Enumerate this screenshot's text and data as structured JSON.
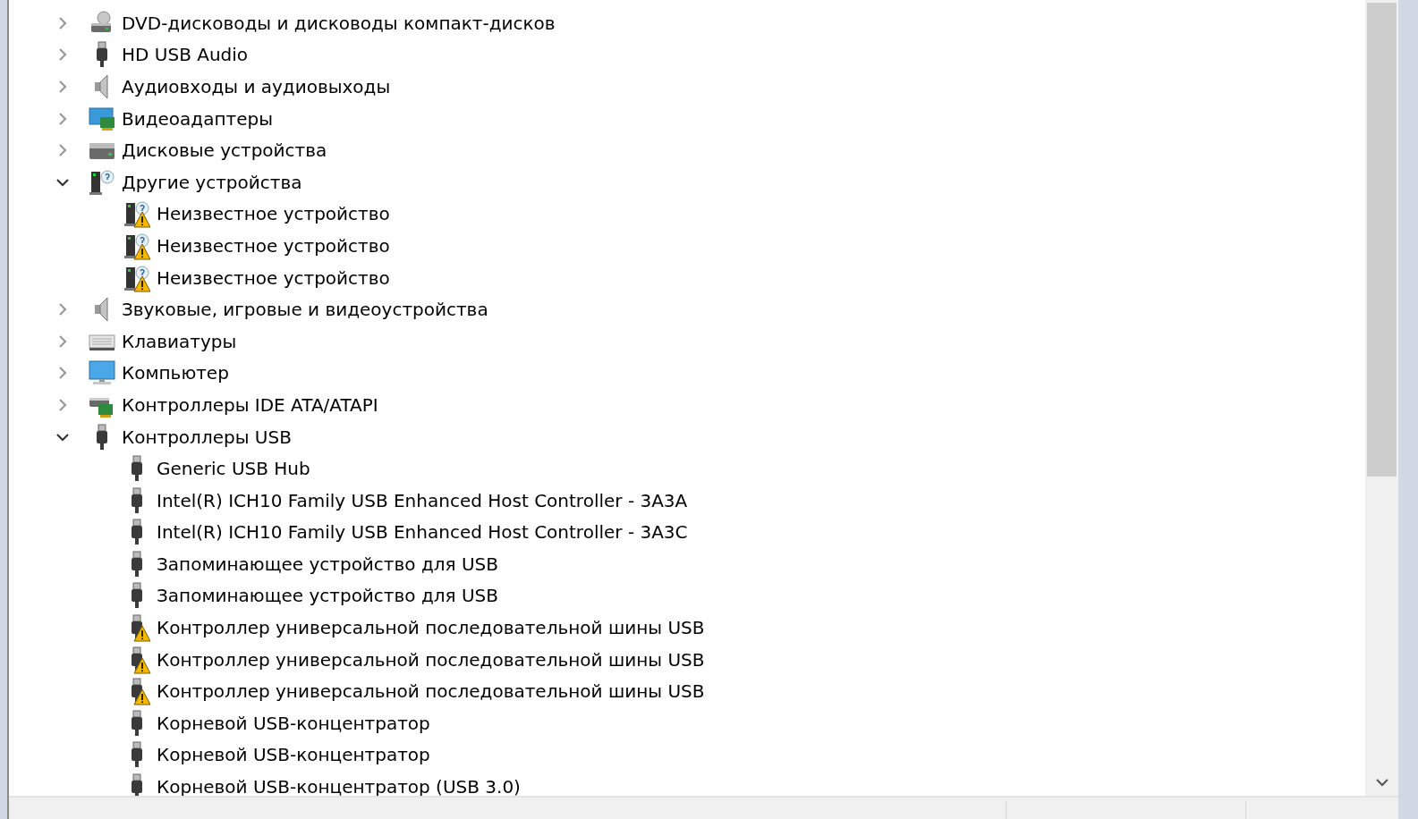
{
  "tree": [
    {
      "label": "DVD-дисководы и дисководы компакт-дисков",
      "kind": "dvd",
      "expanded": false
    },
    {
      "label": "HD USB Audio",
      "kind": "usb",
      "expanded": false
    },
    {
      "label": "Аудиовходы и аудиовыходы",
      "kind": "speaker",
      "expanded": false
    },
    {
      "label": "Видеоадаптеры",
      "kind": "display-adapter",
      "expanded": false
    },
    {
      "label": "Дисковые устройства",
      "kind": "disk",
      "expanded": false
    },
    {
      "label": "Другие устройства",
      "kind": "unknown",
      "expanded": true,
      "children": [
        {
          "label": "Неизвестное устройство",
          "kind": "unknown",
          "warning": true
        },
        {
          "label": "Неизвестное устройство",
          "kind": "unknown",
          "warning": true
        },
        {
          "label": "Неизвестное устройство",
          "kind": "unknown",
          "warning": true
        }
      ]
    },
    {
      "label": "Звуковые, игровые и видеоустройства",
      "kind": "speaker",
      "expanded": false
    },
    {
      "label": "Клавиатуры",
      "kind": "keyboard",
      "expanded": false
    },
    {
      "label": "Компьютер",
      "kind": "monitor",
      "expanded": false
    },
    {
      "label": "Контроллеры IDE ATA/ATAPI",
      "kind": "ide",
      "expanded": false
    },
    {
      "label": "Контроллеры USB",
      "kind": "usb",
      "expanded": true,
      "children": [
        {
          "label": "Generic USB Hub",
          "kind": "usb",
          "warning": false
        },
        {
          "label": "Intel(R) ICH10 Family USB Enhanced Host Controller - 3A3A",
          "kind": "usb",
          "warning": false
        },
        {
          "label": "Intel(R) ICH10 Family USB Enhanced Host Controller - 3A3C",
          "kind": "usb",
          "warning": false
        },
        {
          "label": "Запоминающее устройство для USB",
          "kind": "usb",
          "warning": false
        },
        {
          "label": "Запоминающее устройство для USB",
          "kind": "usb",
          "warning": false
        },
        {
          "label": "Контроллер универсальной последовательной шины USB",
          "kind": "usb",
          "warning": true
        },
        {
          "label": "Контроллер универсальной последовательной шины USB",
          "kind": "usb",
          "warning": true
        },
        {
          "label": "Контроллер универсальной последовательной шины USB",
          "kind": "usb",
          "warning": true
        },
        {
          "label": "Корневой USB-концентратор",
          "kind": "usb",
          "warning": false
        },
        {
          "label": "Корневой USB-концентратор",
          "kind": "usb",
          "warning": false
        },
        {
          "label": "Корневой USB-концентратор (USB 3.0)",
          "kind": "usb",
          "warning": false
        }
      ]
    }
  ]
}
